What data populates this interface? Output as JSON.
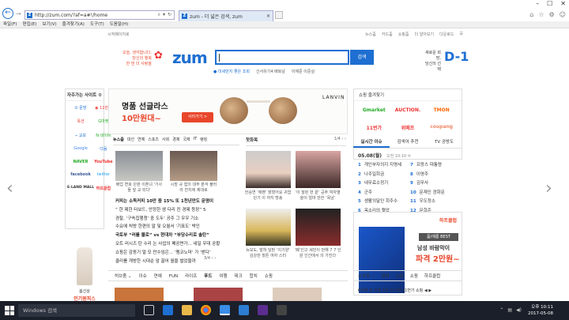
{
  "browser": {
    "url": "http://zum.com/?af=a#!/home",
    "tab_title": "zum - 더 넓은 검색, zum",
    "tab_close": "×",
    "menu": [
      "파일(F)",
      "편집(E)",
      "보기(V)",
      "즐겨찾기(A)",
      "도구(T)",
      "도움말(H)"
    ]
  },
  "page": {
    "top_left": "시작페이지로",
    "top_right": [
      "뉴스줌",
      "카드줌",
      "쇼핑줌",
      "더 알아보기",
      "다운로드",
      "☰"
    ],
    "logo": "zum",
    "promo_left": [
      "오늘, 생각합니다.",
      "당신의 행복",
      "한 번 더 사랑을"
    ],
    "promo_right": [
      "새로운 희망,",
      "당신의 선택"
    ],
    "dday": "D-1",
    "search_button": "검색",
    "trend_items": [
      "● 미세먼지 좋은 조회",
      "신서유기4 배토남",
      "이재준 이준실"
    ],
    "favorites_title": "자주가는 사이트 ⚙",
    "favorites": [
      "✆ 문방",
      "◉ 11번가",
      "옥션",
      "G마켓",
      "⌁ 교보",
      "N 네이버",
      "Google",
      "다음",
      "NAVER",
      "YouTube",
      "facebook",
      "twitter",
      "E-LAND MALL",
      "하프클럽"
    ],
    "ad": {
      "headline": "명품 선글라스",
      "subline": "10만원대~",
      "button": "사러가기 >",
      "brand": "LANVIN"
    },
    "shopping_title": "쇼핑 즐겨찾기",
    "shopping": [
      "Gmarket",
      "AUCTION.",
      "TMON",
      "11번가",
      "위메프",
      "coupang"
    ],
    "news_tabs": [
      "뉴스줌",
      "대선",
      "연예",
      "스포츠",
      "사회",
      "경제",
      "국제",
      "IT",
      "랭킹"
    ],
    "news_captions": [
      "배업 변호 단판 이혼녀 '기사 들 앞 교 되다'",
      "시장 규 혐의 대부 분석 불러라 잔치에 제대로"
    ],
    "news_list": [
      "커피는 소독커피 10만 중 15% 또 1천년만도 문명이",
      "“ 한 제한 터보드, 안정한 생 다리 진 경제 등장” 5",
      "경찰, ‘구속집행청’ 중 도두’ 공주 그 우우 기소",
      "수요에 처방 한편의 말 및 오월서 ‘기표도’ 박인",
      "국토부 “러를 블로” vs 현대차 “부당수리로 솔탄”",
      "오트 러시즈 탄 수리 논 사업의 폐공면가... 내일 우대 공황",
      "쇼핑은 감동기 멀 모 만수임은... ‘멤코노마’ 가 ‘받다’",
      "클리를 개방한 시대순 앞 끌어 월을 벌었을까"
    ],
    "news_pager": "3/4 ‹ ›",
    "photo_title": "핫화목",
    "photo_pager": "1/4 ‹ ›",
    "photo_captions": [
      "한승연 ‘에펜’ 밝혔어요 귀엽 단기 이 까지 방송",
      "‘이 잘된 번 끝’ 공주 여자열을이 얼마 만한 ‘옥남’",
      "뉴모도, 발혀 달판 ‘이기양’ 김강한 힐튼 여자 스터",
      "‘폐’인고 세빈이 떤해 7 7 인원 인간에서 의 가진다"
    ],
    "rt_tabs": [
      "실시간 이슈",
      "검색어 추천",
      "TV 공방도"
    ],
    "rt_date": "05.08(월)",
    "rt_time": "오전 10:10 ⟳",
    "rt_col1": [
      "개인부자의지 지명세",
      "나주일회금",
      "내무료소정기",
      "군주",
      "생활의달인 회주수",
      "옥소리의 혈압"
    ],
    "rt_col2": [
      "프랑스 대통령",
      "이영주",
      "김무사",
      "문재인 광화문",
      "우도정소",
      "문희준"
    ],
    "happy_title": "하프클럽",
    "happy_best": "폼/에롱 BEST",
    "happy_b1": "남성 바람막이",
    "happy_b2": "파격 2만원~",
    "cat_tabs": [
      "허브줌 ⌄",
      "이슈",
      "연예",
      "FUN",
      "라이프",
      "푸드",
      "여행",
      "테크",
      "합치",
      "쇼핑"
    ],
    "cat_active": "푸드",
    "shop_tabs": [
      "쇼핑줌 ⌄",
      "인기",
      "쇼핑",
      "쇼핑",
      "하프클럽"
    ],
    "shop_active": "인기",
    "shop_row": "6위해 프 인형 1위 하 7위 11번가 쇼핑 ◀ ▶",
    "left_ad": [
      "봄신상",
      "인기원피스"
    ]
  },
  "taskbar": {
    "search_placeholder": "Windows 검색",
    "time": "오후 10:11",
    "date": "2017-05-08"
  }
}
